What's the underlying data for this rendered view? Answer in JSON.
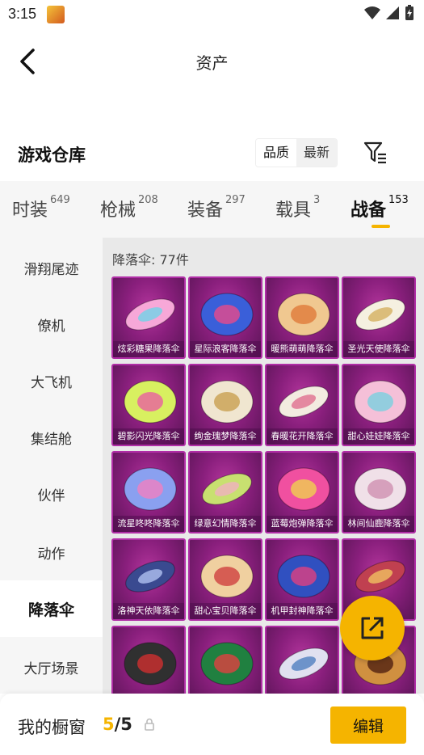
{
  "status_bar": {
    "time": "3:15",
    "app_icon": "game-app-icon"
  },
  "nav": {
    "title": "资产",
    "back_icon": "chevron-left-icon"
  },
  "header": {
    "title": "游戏仓库",
    "sort_options": [
      "品质",
      "最新"
    ],
    "filter_icon": "filter-icon"
  },
  "tabs": [
    {
      "label": "时装",
      "count": "649"
    },
    {
      "label": "枪械",
      "count": "208"
    },
    {
      "label": "装备",
      "count": "297"
    },
    {
      "label": "载具",
      "count": "3"
    },
    {
      "label": "战备",
      "count": "153",
      "active": true
    }
  ],
  "sidebar": {
    "items": [
      "滑翔尾迹",
      "僚机",
      "大飞机",
      "集结舱",
      "伙伴",
      "动作",
      "降落伞",
      "大厅场景"
    ],
    "active_index": 6
  },
  "content": {
    "section_label": "降落伞: 77件",
    "items": [
      "炫彩糖果降落伞",
      "星际浪客降落伞",
      "暖熊萌萌降落伞",
      "圣光天使降落伞",
      "碧影闪光降落伞",
      "绚金瑰梦降落伞",
      "春暖花开降落伞",
      "甜心娃娃降落伞",
      "流星咚咚降落伞",
      "绿意幻情降落伞",
      "蓝莓炮弹降落伞",
      "林间仙鹿降落伞",
      "洛神天依降落伞",
      "甜心宝贝降落伞",
      "机甲封神降落伞",
      "",
      "",
      "",
      "",
      ""
    ]
  },
  "share_fab": {
    "icon": "share-icon"
  },
  "bottom_bar": {
    "label": "我的橱窗",
    "current": "5",
    "separator": "/",
    "max": "5",
    "lock_icon": "lock-icon",
    "edit_label": "编辑"
  },
  "colors": {
    "accent": "#f5b400",
    "card_bg": "#8a1f7d",
    "card_border": "#b02ea6"
  }
}
